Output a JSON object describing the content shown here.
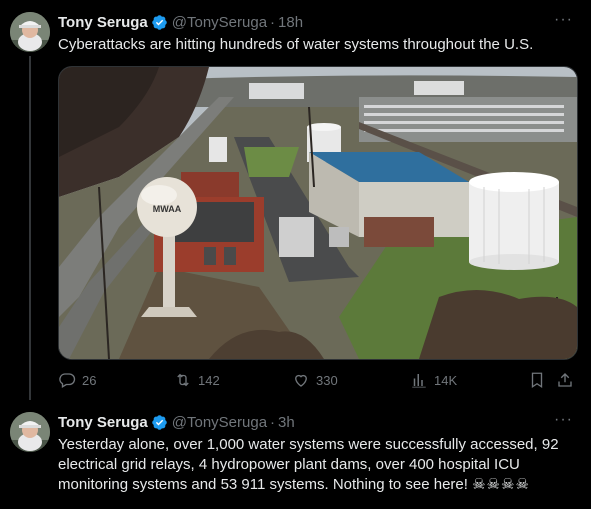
{
  "tweets": [
    {
      "name": "Tony Seruga",
      "handle": "@TonySeruga",
      "time": "18h",
      "text": "Cyberattacks are hitting hundreds of water systems throughout the U.S.",
      "image_label": "MWAA",
      "actions": {
        "replies": "26",
        "reposts": "142",
        "likes": "330",
        "views": "14K"
      }
    },
    {
      "name": "Tony Seruga",
      "handle": "@TonySeruga",
      "time": "3h",
      "text": "Yesterday alone, over 1,000 water systems were successfully accessed, 92 electrical grid relays, 4 hydropower plant dams, over 400 hospital ICU monitoring systems and 53 911 systems. Nothing to see here!",
      "emoji": "☠☠☠☠"
    }
  ],
  "icons": {
    "verified": "verified-badge-icon",
    "more": "more-icon",
    "reply": "reply-icon",
    "repost": "repost-icon",
    "like": "like-icon",
    "views": "views-icon",
    "bookmark": "bookmark-icon",
    "share": "share-icon"
  },
  "colors": {
    "background": "#000000",
    "text": "#e7e9ea",
    "muted": "#71767b",
    "verified": "#1d9bf0"
  }
}
